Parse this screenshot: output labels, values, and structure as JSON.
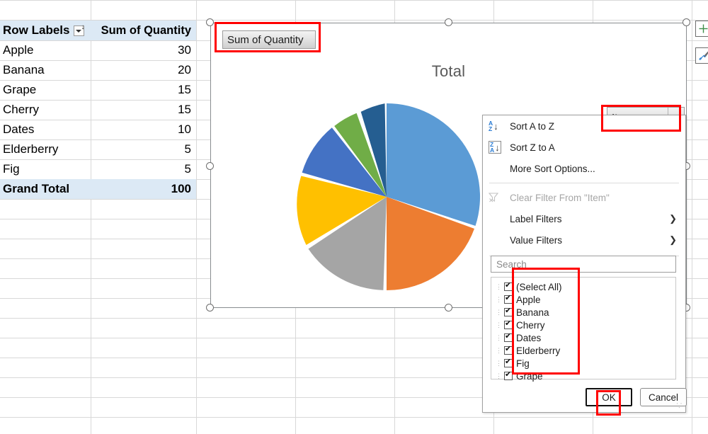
{
  "pivot_table": {
    "header": {
      "row_labels": "Row Labels",
      "value_header": "Sum of Quantity"
    },
    "rows": [
      {
        "label": "Apple",
        "value": "30"
      },
      {
        "label": "Banana",
        "value": "20"
      },
      {
        "label": "Grape",
        "value": "15"
      },
      {
        "label": "Cherry",
        "value": "15"
      },
      {
        "label": "Dates",
        "value": "10"
      },
      {
        "label": "Elderberry",
        "value": "5"
      },
      {
        "label": "Fig",
        "value": "5"
      }
    ],
    "grand_total": {
      "label": "Grand Total",
      "value": "100"
    }
  },
  "chart": {
    "title": "Total",
    "value_field_button": "Sum of Quantity",
    "axis_field_button": "Item"
  },
  "chart_data": {
    "type": "pie",
    "title": "Total",
    "categories": [
      "Apple",
      "Banana",
      "Cherry",
      "Grape",
      "Dates",
      "Elderberry",
      "Fig"
    ],
    "values": [
      30,
      20,
      15,
      15,
      10,
      5,
      5
    ],
    "colors": [
      "#5B9BD5",
      "#ED7D31",
      "#A5A5A5",
      "#FFC000",
      "#4472C4",
      "#70AD47",
      "#255E91"
    ],
    "total": 100,
    "legend": "none",
    "data_labels": false,
    "start_angle_deg": 0,
    "slice_gap_deg": 1.2
  },
  "filter_menu": {
    "items": [
      {
        "label": "Sort A to Z",
        "accel": "S",
        "icon": "sort-az-icon",
        "disabled": false,
        "submenu": false
      },
      {
        "label": "Sort Z to A",
        "accel": "o",
        "icon": "sort-za-icon",
        "disabled": false,
        "submenu": false
      },
      {
        "label": "More Sort Options...",
        "accel": "M",
        "icon": "none",
        "disabled": false,
        "submenu": false
      },
      {
        "label": "Clear Filter From \"Item\"",
        "accel": "C",
        "icon": "clear-filter-icon",
        "disabled": true,
        "submenu": false
      },
      {
        "label": "Label Filters",
        "accel": "L",
        "icon": "none",
        "disabled": false,
        "submenu": true
      },
      {
        "label": "Value Filters",
        "accel": "V",
        "icon": "none",
        "disabled": false,
        "submenu": true
      }
    ],
    "submenu_arrow": "❯",
    "search": {
      "placeholder": "Search",
      "value": ""
    },
    "checklist": [
      {
        "label": "(Select All)",
        "checked": true
      },
      {
        "label": "Apple",
        "checked": true
      },
      {
        "label": "Banana",
        "checked": true
      },
      {
        "label": "Cherry",
        "checked": true
      },
      {
        "label": "Dates",
        "checked": true
      },
      {
        "label": "Elderberry",
        "checked": true
      },
      {
        "label": "Fig",
        "checked": true
      },
      {
        "label": "Grape",
        "checked": true
      }
    ],
    "ok_label": "OK",
    "cancel_label": "Cancel"
  },
  "side_buttons": {
    "chart_elements": "+",
    "chart_styles": "brush"
  },
  "highlight_color": "#FF0000"
}
